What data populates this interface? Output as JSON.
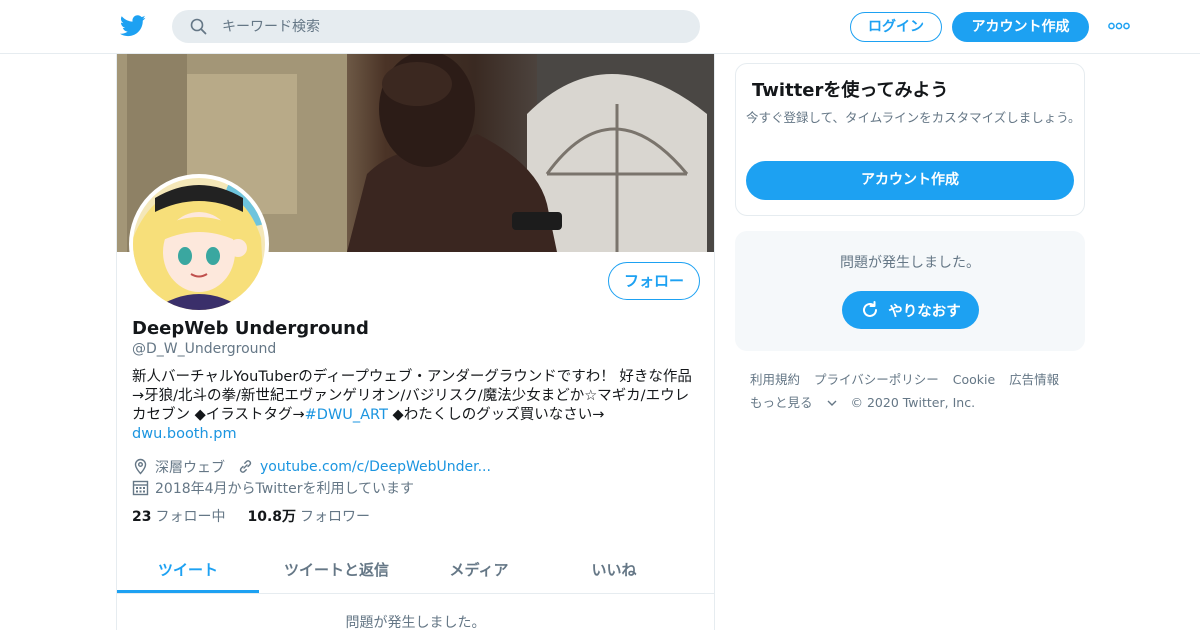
{
  "header": {
    "search_placeholder": "キーワード検索",
    "login_label": "ログイン",
    "signup_label": "アカウント作成"
  },
  "profile": {
    "follow_label": "フォロー",
    "name": "DeepWeb Underground",
    "handle": "@D_W_Underground",
    "bio_text": "新人バーチャルYouTuberのディープウェブ・アンダーグラウンドですわ！ 好きな作品→牙狼/北斗の拳/新世紀エヴァンゲリオン/バジリスク/魔法少女まどか☆マギカ/エウレカセブン ◆イラストタグ→",
    "bio_hashtag": "#DWU_ART",
    "bio_text2": " ◆わたくしのグッズ買いなさい→",
    "bio_link": "dwu.booth.pm",
    "location": "深層ウェブ",
    "website": "youtube.com/c/DeepWebUnder...",
    "joined": "2018年4月からTwitterを利用しています",
    "following_count": "23",
    "following_label": "フォロー中",
    "followers_count": "10.8万",
    "followers_label": "フォロワー"
  },
  "tabs": [
    {
      "label": "ツイート",
      "active": true
    },
    {
      "label": "ツイートと返信",
      "active": false
    },
    {
      "label": "メディア",
      "active": false
    },
    {
      "label": "いいね",
      "active": false
    }
  ],
  "timeline": {
    "error_text": "問題が発生しました。"
  },
  "sidebar": {
    "card_title": "Twitterを使ってみよう",
    "card_subtitle": "今すぐ登録して、タイムラインをカスタマイズしましょう。",
    "card_button": "アカウント作成",
    "error_text": "問題が発生しました。",
    "retry_label": "やりなおす"
  },
  "footer": {
    "links": [
      "利用規約",
      "プライバシーポリシー",
      "Cookie",
      "広告情報"
    ],
    "more_label": "もっと見る",
    "copyright": "© 2020 Twitter, Inc."
  },
  "colors": {
    "accent": "#1da1f2",
    "text_secondary": "#657786",
    "border": "#e6ecf0"
  }
}
